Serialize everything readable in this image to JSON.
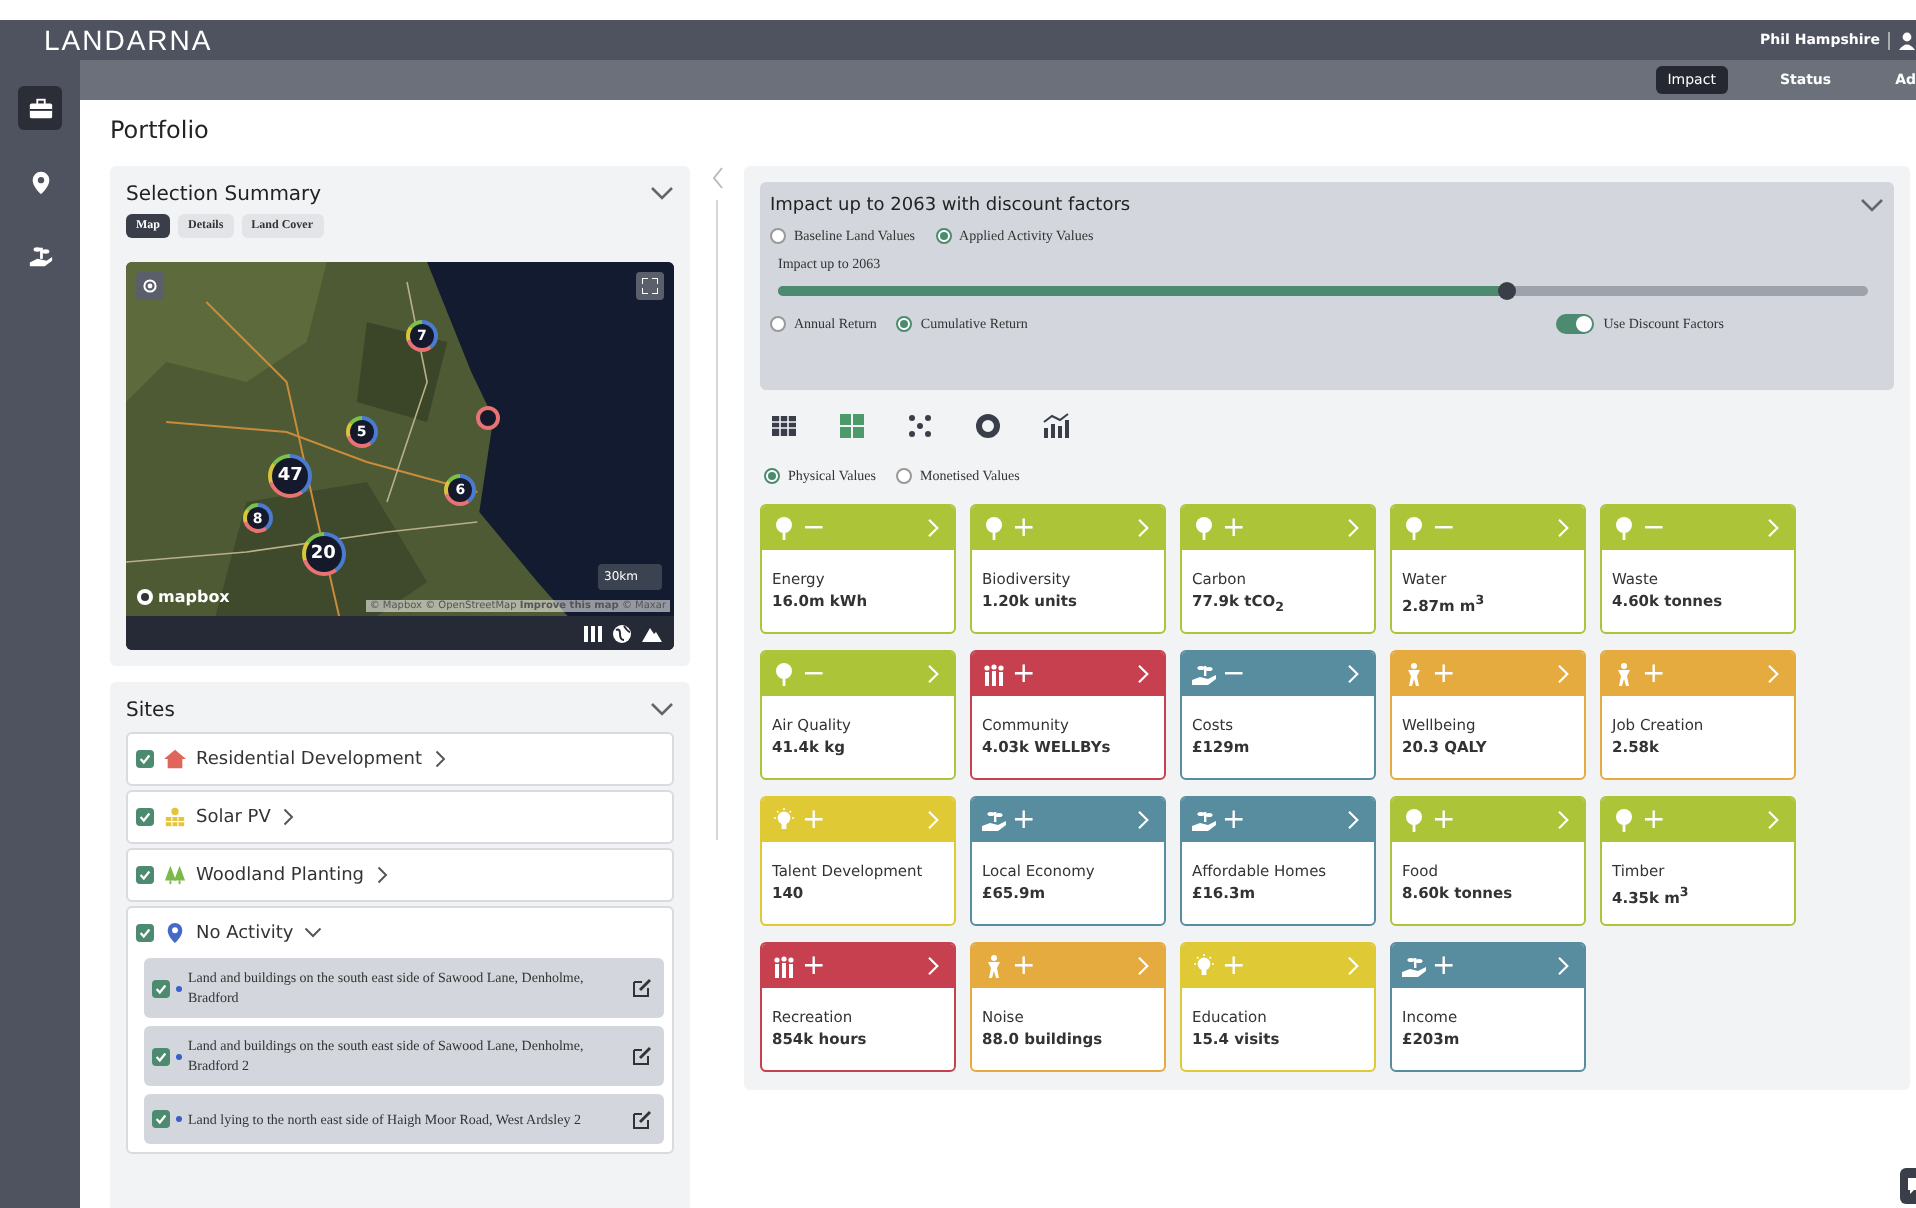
{
  "app": {
    "logo": "LANDARNA",
    "user": "Phil Hampshire"
  },
  "rail": [
    {
      "kind": "briefcase",
      "selected": true
    },
    {
      "kind": "pin",
      "selected": false
    },
    {
      "kind": "hand",
      "selected": false
    }
  ],
  "nav_tabs": [
    {
      "label": "Impact",
      "selected": true
    },
    {
      "label": "Status",
      "selected": false
    },
    {
      "label": "Ad",
      "selected": false
    }
  ],
  "page_title": "Portfolio",
  "selection_summary": {
    "title": "Selection Summary",
    "expanded": true,
    "tabs": [
      {
        "label": "Map",
        "selected": true
      },
      {
        "label": "Details",
        "selected": false
      },
      {
        "label": "Land Cover",
        "selected": false
      }
    ],
    "map": {
      "clusters": [
        {
          "count": "7"
        },
        {
          "count": "5"
        },
        {
          "count": "47"
        },
        {
          "count": "8"
        },
        {
          "count": "20"
        },
        {
          "count": "6"
        }
      ],
      "scale": "30km",
      "logo": "mapbox",
      "attribution": "© Mapbox © OpenStreetMap **Improve this map** © Maxar"
    }
  },
  "sites": {
    "title": "Sites",
    "expanded": true,
    "groups": [
      {
        "kind": "house",
        "label": "Residential Development",
        "checked": true,
        "expanded": false
      },
      {
        "kind": "solar",
        "label": "Solar PV",
        "checked": true,
        "expanded": false
      },
      {
        "kind": "trees",
        "label": "Woodland Planting",
        "checked": true,
        "expanded": false
      },
      {
        "kind": "pin",
        "label": "No Activity",
        "checked": true,
        "expanded": true,
        "children": [
          {
            "label": "Land and buildings on the south east side of Sawood Lane, Denholme, Bradford",
            "checked": true
          },
          {
            "label": "Land and buildings on the south east side of Sawood Lane, Denholme, Bradford 2",
            "checked": true
          },
          {
            "label": "Land lying to the north east side of Haigh Moor Road, West Ardsley 2",
            "checked": true
          }
        ]
      }
    ]
  },
  "impact": {
    "title": "Impact up to 2063 with discount factors",
    "expanded": true,
    "value_basis": [
      {
        "label": "Baseline Land Values",
        "selected": false
      },
      {
        "label": "Applied Activity Values",
        "selected": true
      }
    ],
    "slider": {
      "label": "Impact up to 2063",
      "level": 0.667
    },
    "return_type": [
      {
        "label": "Annual Return",
        "selected": false
      },
      {
        "label": "Cumulative Return",
        "selected": true
      }
    ],
    "discount_toggle": {
      "label": "Use Discount Factors",
      "on": true
    },
    "views": [
      {
        "kind": "table",
        "selected": false
      },
      {
        "kind": "grid",
        "selected": true
      },
      {
        "kind": "scatter",
        "selected": false
      },
      {
        "kind": "donut",
        "selected": false
      },
      {
        "kind": "bars",
        "selected": false
      }
    ],
    "value_type": [
      {
        "label": "Physical Values",
        "selected": true
      },
      {
        "label": "Monetised Values",
        "selected": false
      }
    ],
    "cards": [
      {
        "kind": "tree",
        "color": "#acc437",
        "sign": "−",
        "label": "Energy",
        "value": "16.0m kWh"
      },
      {
        "kind": "tree",
        "color": "#acc437",
        "sign": "+",
        "label": "Biodiversity",
        "value": "1.20k units"
      },
      {
        "kind": "tree",
        "color": "#acc437",
        "sign": "+",
        "label": "Carbon",
        "value": "77.9k tCO$_{2}$"
      },
      {
        "kind": "tree",
        "color": "#acc437",
        "sign": "−",
        "label": "Water",
        "value": "2.87m m$^{3}$"
      },
      {
        "kind": "tree",
        "color": "#acc437",
        "sign": "−",
        "label": "Waste",
        "value": "4.60k tonnes"
      },
      {
        "kind": "tree",
        "color": "#acc437",
        "sign": "−",
        "label": "Air Quality",
        "value": "41.4k kg"
      },
      {
        "kind": "people",
        "color": "#c7404f",
        "sign": "+",
        "label": "Community",
        "value": "4.03k WELLBYs"
      },
      {
        "kind": "hand",
        "color": "#588c9f",
        "sign": "−",
        "label": "Costs",
        "value": "£129m"
      },
      {
        "kind": "person",
        "color": "#e5ab3f",
        "sign": "+",
        "label": "Wellbeing",
        "value": "20.3 QALY"
      },
      {
        "kind": "person",
        "color": "#e5ab3f",
        "sign": "+",
        "label": "Job Creation",
        "value": "2.58k"
      },
      {
        "kind": "bulb",
        "color": "#dfc935",
        "sign": "+",
        "label": "Talent Development",
        "value": "140"
      },
      {
        "kind": "hand",
        "color": "#588c9f",
        "sign": "+",
        "label": "Local Economy",
        "value": "£65.9m"
      },
      {
        "kind": "hand",
        "color": "#588c9f",
        "sign": "+",
        "label": "Affordable Homes",
        "value": "£16.3m"
      },
      {
        "kind": "tree",
        "color": "#acc437",
        "sign": "+",
        "label": "Food",
        "value": "8.60k tonnes"
      },
      {
        "kind": "tree",
        "color": "#acc437",
        "sign": "+",
        "label": "Timber",
        "value": "4.35k m$^{3}$"
      },
      {
        "kind": "people",
        "color": "#c7404f",
        "sign": "+",
        "label": "Recreation",
        "value": "854k hours"
      },
      {
        "kind": "person",
        "color": "#e5ab3f",
        "sign": "+",
        "label": "Noise",
        "value": "88.0 buildings"
      },
      {
        "kind": "bulb",
        "color": "#dfc935",
        "sign": "+",
        "label": "Education",
        "value": "15.4 visits"
      },
      {
        "kind": "hand",
        "color": "#588c9f",
        "sign": "+",
        "label": "Income",
        "value": "£203m"
      }
    ]
  }
}
